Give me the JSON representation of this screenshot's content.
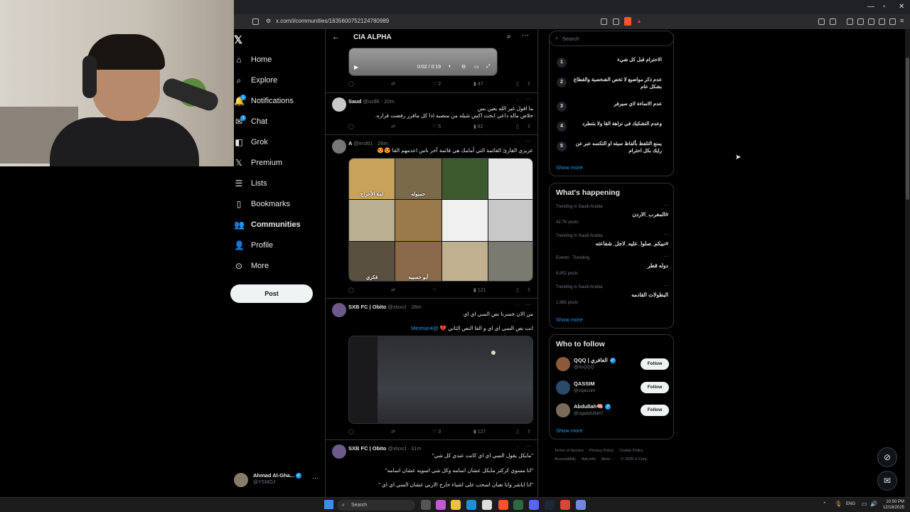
{
  "browser": {
    "url": "x.com/i/communities/1835600752124780989"
  },
  "nav": {
    "items": [
      {
        "label": "Home",
        "icon": "home-icon",
        "active": false
      },
      {
        "label": "Explore",
        "icon": "search-icon",
        "active": false
      },
      {
        "label": "Notifications",
        "icon": "bell-icon",
        "active": false,
        "badge": "1"
      },
      {
        "label": "Chat",
        "icon": "mail-icon",
        "active": false,
        "badge": "1"
      },
      {
        "label": "Grok",
        "icon": "grok-icon",
        "active": false
      },
      {
        "label": "Premium",
        "icon": "x-icon",
        "active": false
      },
      {
        "label": "Lists",
        "icon": "list-icon",
        "active": false
      },
      {
        "label": "Bookmarks",
        "icon": "bookmark-icon",
        "active": false
      },
      {
        "label": "Communities",
        "icon": "people-icon",
        "active": true
      },
      {
        "label": "Profile",
        "icon": "person-icon",
        "active": false
      },
      {
        "label": "More",
        "icon": "more-circle-icon",
        "active": false
      }
    ],
    "post_label": "Post",
    "account": {
      "name": "Ahmad Al-Gha...",
      "handle": "@YSMOJ"
    }
  },
  "feed": {
    "title": "CIA ALPHA",
    "first_actions": {
      "likes": "2",
      "views": "47"
    },
    "video_time": "0:02 / 0:19",
    "tweets": [
      {
        "name": "Saud",
        "handle": "@ucll8",
        "time": "20m",
        "lines": [
          "ما اقول غير الله يعين بس",
          "خلاص ماله داعي ابحث اكس شيله من منصبه اذا كل ماقرر رفضت قراره."
        ],
        "likes": "5",
        "views": "82"
      },
      {
        "name": "A",
        "handle": "@trrd61",
        "time": "28m",
        "lines": [
          "عزيزي القارئ القائمة التي أمامك هي قائمة آخر ناس اعدمهم القا 😍😍"
        ],
        "likes": "",
        "views": "121",
        "image_captions": [
          "لمة الأحراج",
          "حمبوله",
          "",
          "",
          "",
          "",
          "",
          "",
          "فكري",
          "أبو حسيبه",
          "",
          ""
        ]
      },
      {
        "name": "SXB FC | Obito",
        "handle": "@xlxxcl",
        "time": "28m",
        "lines": [
          "من الان خسرنا نص السي اي اي",
          "انت نص السي اي اي و القا النص الثاني 💔 @Meshari4"
        ],
        "likes": "3",
        "views": "127"
      },
      {
        "name": "SXB FC | Obito",
        "handle": "@xlxxcl",
        "time": "31m",
        "lines": [
          "\"مايكل يقول السي اي اي كانت عندي كل شي\"",
          "\"انا مسوي كركتر مايكل عشان اسامه وكل شي اسويه عشان اسامه\"",
          "\"انا اباشر وانا تعبان اسحب على اشياء خارج الاربي عشان السي اي اي \""
        ]
      }
    ]
  },
  "right": {
    "search_placeholder": "Search",
    "rules": [
      {
        "num": "1",
        "text": "الاحترام قبل كل شيء"
      },
      {
        "num": "2",
        "text": "عدم ذكر مواضيع لا تخص الشخصية والقطاع بشكل عام"
      },
      {
        "num": "3",
        "text": "عدم الاساءة لاي سيرفر"
      },
      {
        "num": "4",
        "text": "وعدم التشكيك في نزاهة القا ولا بتنطرد"
      },
      {
        "num": "5",
        "text": "يمنع التلفظ بألفاظ سيئه او التكسه عبر عن رايك بكل احترام"
      }
    ],
    "show_more": "Show more",
    "happening_title": "What's happening",
    "trends": [
      {
        "meta": "Trending in Saudi Arabia",
        "name": "#المغرب_الاردن",
        "count": "42.7K posts"
      },
      {
        "meta": "Trending in Saudi Arabia",
        "name": "#نبيكم_صلوا_عليه_لاجل_شفاعته",
        "count": ""
      },
      {
        "meta": "Events · Trending",
        "name": "دوله قطر",
        "count": "8,952 posts"
      },
      {
        "meta": "Trending in Saudi Arabia",
        "name": "البطولات القادمه",
        "count": "1,965 posts"
      }
    ],
    "wtf_title": "Who to follow",
    "follow_label": "Follow",
    "who_to_follow": [
      {
        "name": "QQQ | الغافري",
        "handle": "@ItsQQQ",
        "verified": true
      },
      {
        "name": "QASSIM",
        "handle": "@vqassim",
        "verified": false
      },
      {
        "name": "Abdullah🧠",
        "handle": "@ogabdullah7",
        "verified": true
      }
    ],
    "footer": [
      "Terms of Service",
      "Privacy Policy",
      "Cookie Policy",
      "Accessibility",
      "Ads info",
      "More ···",
      "© 2025 X Corp."
    ]
  },
  "taskbar": {
    "search": "Search",
    "lang": "ENG",
    "time": "10:50 PM",
    "date": "12/18/2025"
  }
}
